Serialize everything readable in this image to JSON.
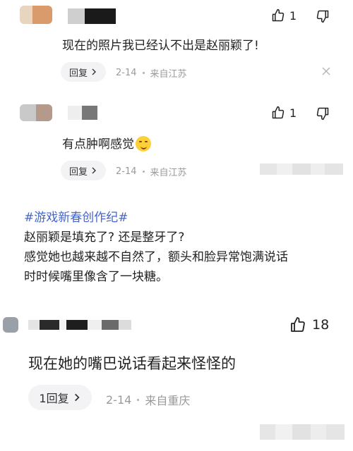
{
  "comments": [
    {
      "text": "现在的照片我已经认不出是赵丽颖了!",
      "likes": "1",
      "reply_label": "回复",
      "date": "2-14",
      "location": "来自江苏"
    },
    {
      "text": "有点肿啊感觉",
      "emoji": "😏",
      "likes": "1",
      "reply_label": "回复",
      "date": "2-14",
      "location": "来自江苏"
    },
    {
      "text": "现在她的嘴巴说话看起来怪怪的",
      "likes": "18",
      "reply_label": "1回复",
      "date": "2-14",
      "location": "来自重庆"
    }
  ],
  "post": {
    "tag": "#游戏新春创作纪#",
    "lines": [
      "赵丽颖是填充了? 还是整牙了?",
      "感觉她也越来越不自然了，额头和脸异常饱满说话",
      "时时候嘴里像含了一块糖。"
    ]
  },
  "icons": {
    "like": "thumbs-up-icon",
    "dislike": "thumbs-down-icon",
    "close": "close-icon",
    "chevron": "chevron-right-icon"
  },
  "colors": {
    "tag": "#4466cc",
    "meta": "#9a9a9a",
    "pill_bg": "#f3f3f5"
  }
}
